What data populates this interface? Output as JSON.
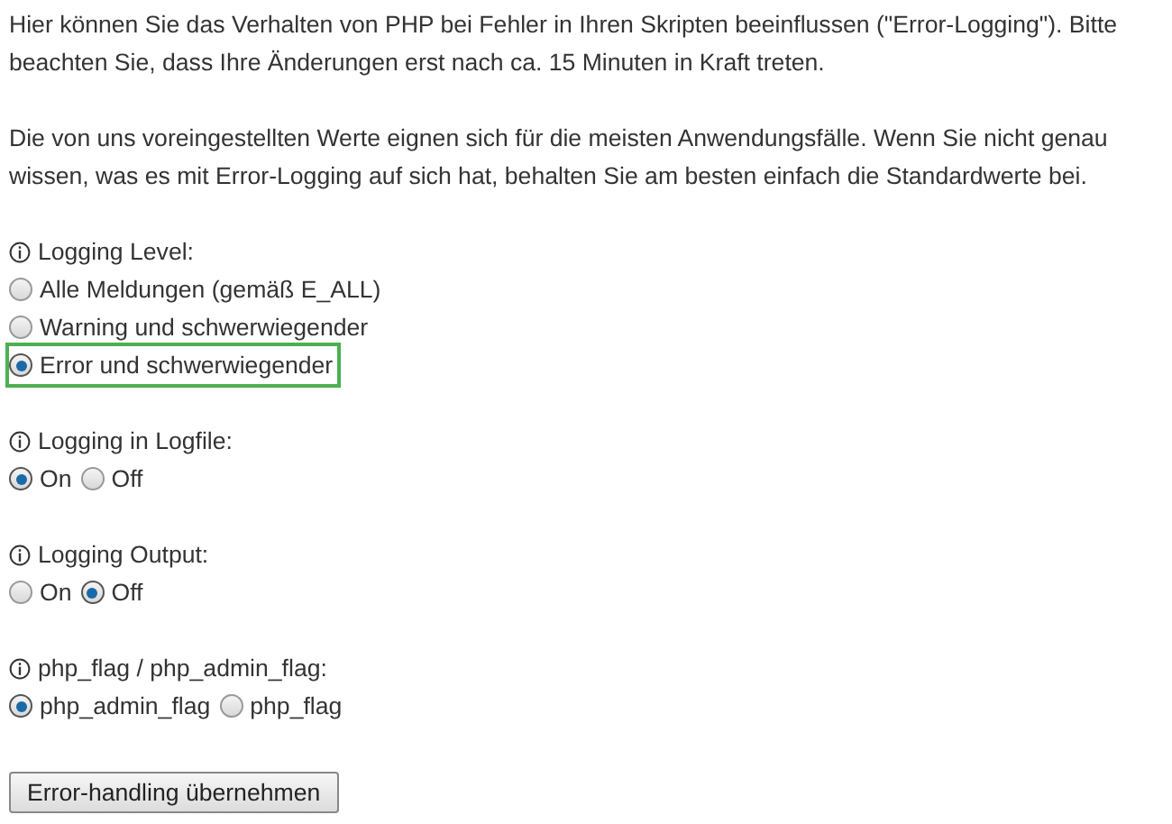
{
  "intro": [
    "Hier können Sie das Verhalten von PHP bei Fehler in Ihren Skripten beeinflussen (\"Error-Logging\"). Bitte beachten Sie, dass Ihre Änderungen erst nach ca. 15 Minuten in Kraft treten.",
    "Die von uns voreingestellten Werte eignen sich für die meisten Anwendungsfälle. Wenn Sie nicht genau wissen, was es mit Error-Logging auf sich hat, behalten Sie am besten einfach die Standardwerte bei."
  ],
  "settings": [
    {
      "label": "Logging Level:",
      "kind": "stacked",
      "options": [
        {
          "label": "Alle Meldungen (gemäß E_ALL)",
          "selected": false,
          "highlighted": false
        },
        {
          "label": "Warning und schwerwiegender",
          "selected": false,
          "highlighted": false
        },
        {
          "label": "Error und schwerwiegender",
          "selected": true,
          "highlighted": true
        }
      ]
    },
    {
      "label": "Logging in Logfile:",
      "kind": "inline",
      "options": [
        {
          "label": "On",
          "selected": true,
          "highlighted": false
        },
        {
          "label": "Off",
          "selected": false,
          "highlighted": false
        }
      ]
    },
    {
      "label": "Logging Output:",
      "kind": "inline",
      "options": [
        {
          "label": "On",
          "selected": false,
          "highlighted": false
        },
        {
          "label": "Off",
          "selected": true,
          "highlighted": false
        }
      ]
    },
    {
      "label": "php_flag / php_admin_flag:",
      "kind": "inline",
      "options": [
        {
          "label": "php_admin_flag",
          "selected": true,
          "highlighted": false
        },
        {
          "label": "php_flag",
          "selected": false,
          "highlighted": false
        }
      ]
    }
  ],
  "submit_button": "Error-handling übernehmen"
}
